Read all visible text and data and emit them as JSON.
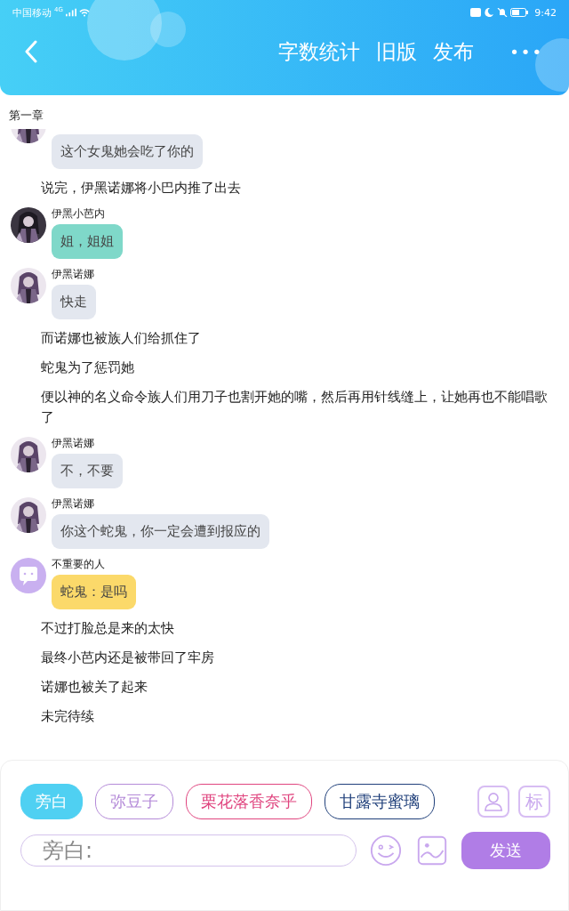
{
  "status_bar": {
    "carrier": "中国移动",
    "network": "4G",
    "time": "9:42"
  },
  "toolbar": {
    "actions": [
      "字数统计",
      "旧版",
      "发布"
    ],
    "more": "•••"
  },
  "chapter": "第一章",
  "messages": [
    {
      "kind": "character",
      "text": "这个女鬼她会吃了你的",
      "color": "#e3e7ef"
    },
    {
      "kind": "narration",
      "text": "说完，伊黑诺娜将小巴内推了出去"
    },
    {
      "kind": "character",
      "name": "伊黑小芭内",
      "text": "姐，姐姐",
      "color": "#7fd8c9"
    },
    {
      "kind": "character",
      "name": "伊黑诺娜",
      "text": "快走",
      "color": "#e3e7ef"
    },
    {
      "kind": "narration",
      "text": "而诺娜也被族人们给抓住了"
    },
    {
      "kind": "narration",
      "text": "蛇鬼为了惩罚她"
    },
    {
      "kind": "narration",
      "text": "便以神的名义命令族人们用刀子也割开她的嘴，然后再用针线缝上，让她再也不能唱歌了"
    },
    {
      "kind": "character",
      "name": "伊黑诺娜",
      "text": "不，不要",
      "color": "#e3e7ef"
    },
    {
      "kind": "character",
      "name": "伊黑诺娜",
      "text": "你这个蛇鬼，你一定会遭到报应的",
      "color": "#e3e7ef"
    },
    {
      "kind": "extra",
      "name": "不重要的人",
      "text": "蛇鬼：是吗",
      "color": "#fbd96a"
    },
    {
      "kind": "narration",
      "text": "不过打脸总是来的太快"
    },
    {
      "kind": "narration",
      "text": "最终小芭内还是被带回了牢房"
    },
    {
      "kind": "narration",
      "text": "诺娜也被关了起来"
    },
    {
      "kind": "narration",
      "text": "未完待续"
    }
  ],
  "characters": [
    {
      "label": "旁白",
      "selected": true,
      "color": "#4fd0f2"
    },
    {
      "label": "弥豆子",
      "selected": false,
      "color": "#b48ad8"
    },
    {
      "label": "栗花落香奈乎",
      "selected": false,
      "color": "#e0457f"
    },
    {
      "label": "甘露寺蜜璃",
      "selected": false,
      "color": "#1f3f7a"
    }
  ],
  "mark_button": "标",
  "input": {
    "placeholder": "旁白:"
  },
  "send_button": "发送"
}
